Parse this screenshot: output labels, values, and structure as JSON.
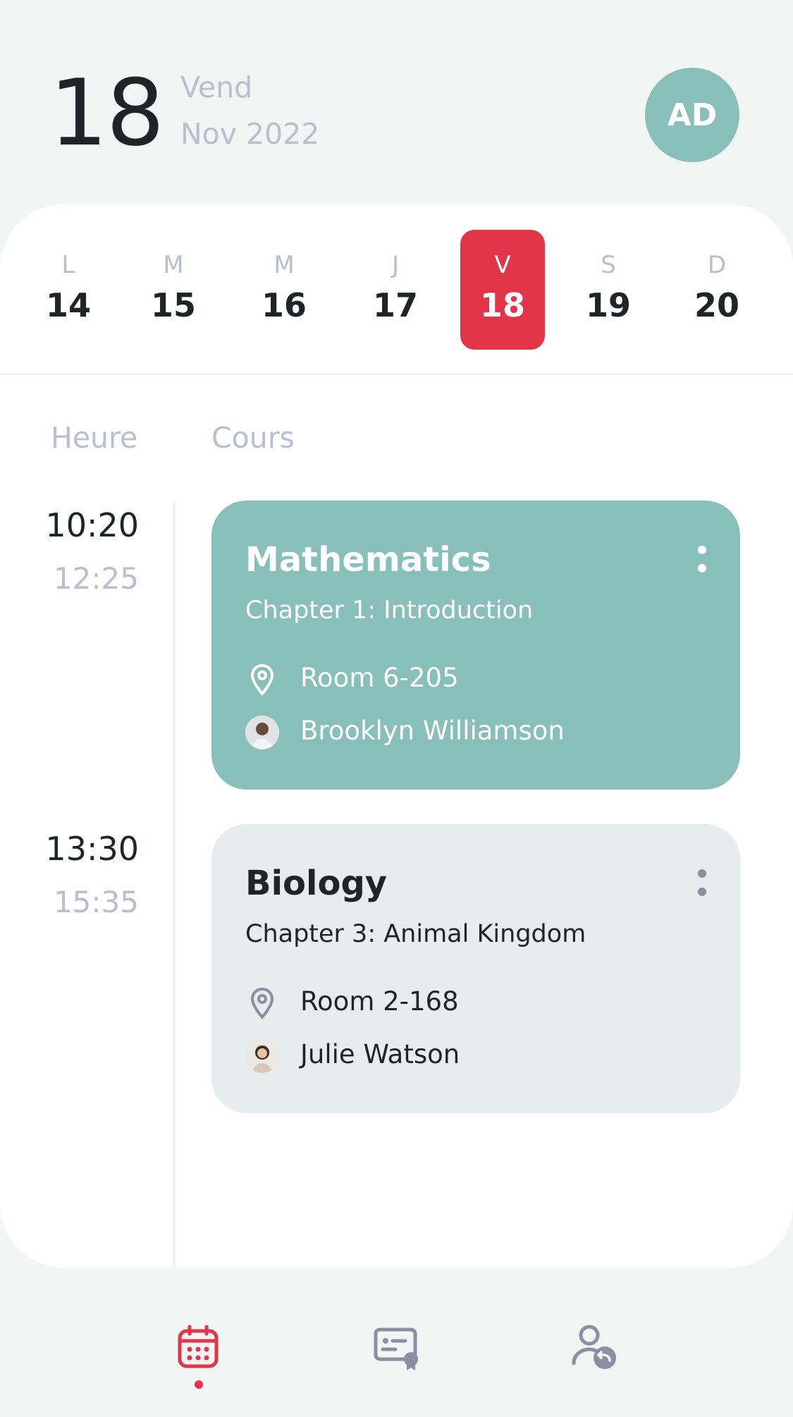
{
  "header": {
    "day_number": "18",
    "weekday": "Vend",
    "month_year": "Nov 2022",
    "avatar_initials": "AD"
  },
  "week": [
    {
      "letter": "L",
      "num": "14"
    },
    {
      "letter": "M",
      "num": "15"
    },
    {
      "letter": "M",
      "num": "16"
    },
    {
      "letter": "J",
      "num": "17"
    },
    {
      "letter": "V",
      "num": "18"
    },
    {
      "letter": "S",
      "num": "19"
    },
    {
      "letter": "D",
      "num": "20"
    }
  ],
  "columns": {
    "time": "Heure",
    "course": "Cours"
  },
  "courses": [
    {
      "start": "10:20",
      "end": "12:25",
      "title": "Mathematics",
      "chapter": "Chapter 1: Introduction",
      "room": "Room 6-205",
      "teacher": "Brooklyn Williamson"
    },
    {
      "start": "13:30",
      "end": "15:35",
      "title": "Biology",
      "chapter": "Chapter 3: Animal Kingdom",
      "room": "Room 2-168",
      "teacher": "Julie Watson"
    }
  ],
  "nav": {
    "icons": [
      "calendar-icon",
      "certificate-icon",
      "user-switch-icon"
    ]
  },
  "colors": {
    "accent": "#e23547",
    "teal": "#88bfb8",
    "card_gray": "#e5eded"
  }
}
